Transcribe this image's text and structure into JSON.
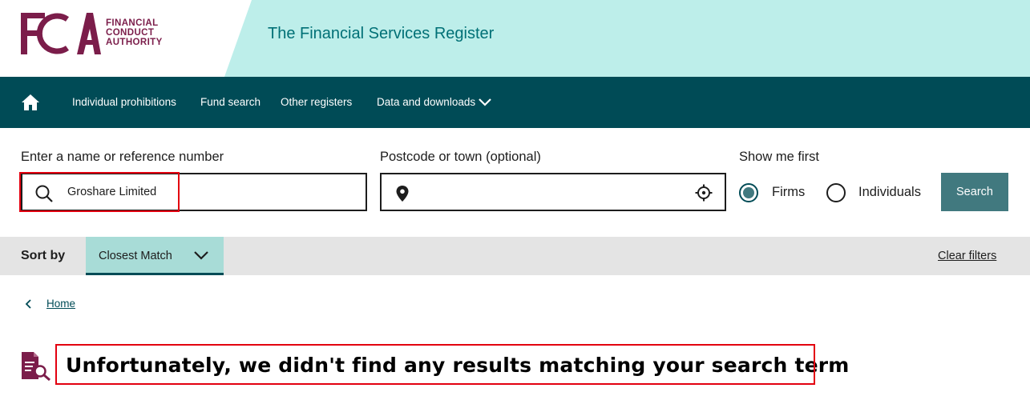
{
  "header": {
    "logo_letters": "FCA",
    "logo_lines": [
      "FINANCIAL",
      "CONDUCT",
      "AUTHORITY"
    ],
    "site_title": "The Financial Services Register"
  },
  "nav": {
    "home_icon": "home-icon",
    "items": [
      {
        "label": "Individual prohibitions"
      },
      {
        "label": "Fund search"
      },
      {
        "label": "Other registers"
      },
      {
        "label": "Data and downloads"
      }
    ]
  },
  "search": {
    "name_label": "Enter a name or reference number",
    "name_value": "Groshare Limited",
    "location_label": "Postcode or town (optional)",
    "location_value": "",
    "show_first_label": "Show me first",
    "options": [
      {
        "label": "Firms",
        "checked": true
      },
      {
        "label": "Individuals",
        "checked": false
      }
    ],
    "button_label": "Search"
  },
  "sort": {
    "label": "Sort by",
    "selected": "Closest Match",
    "clear_filters": "Clear filters"
  },
  "breadcrumb": {
    "home": "Home"
  },
  "results": {
    "message": "Unfortunately, we didn't find any results matching your search term"
  },
  "colors": {
    "nav_bg": "#004b56",
    "header_band": "#bdeeea",
    "brand_maroon": "#7b1d4a",
    "title_teal": "#007076",
    "button_bg": "#41797f",
    "sort_select_bg": "#a8dcd7",
    "highlight_red": "#e3000f"
  }
}
